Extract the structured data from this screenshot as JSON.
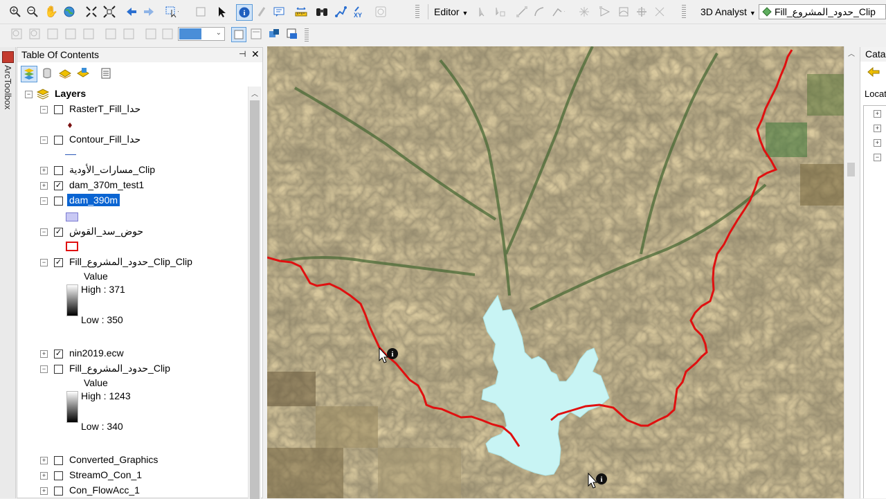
{
  "toolbar": {
    "editor_label": "Editor",
    "analyst_label": "3D Analyst",
    "layer_dropdown": "Fill_حدود_المشروع_Clip",
    "zoom_box": "",
    "xy_label": "XY"
  },
  "arctoolbox": {
    "label": "ArcToolbox"
  },
  "toc": {
    "title": "Table Of Contents",
    "pin_label": "📌",
    "close_label": "✕",
    "root": "Layers",
    "layers": [
      {
        "name": "RasterT_Fill_حدا",
        "checked": false
      },
      {
        "name": "Contour_Fill_حدا",
        "checked": false
      },
      {
        "name": "مسارات_الأودية_Clip",
        "checked": false
      },
      {
        "name": "dam_370m_test1",
        "checked": true
      },
      {
        "name": "dam_390m",
        "checked": false
      },
      {
        "name": "حوض_سد_القوش",
        "checked": true
      },
      {
        "name": "Fill_حدود_المشروع_Clip_Clip",
        "checked": true
      },
      {
        "name": "nin2019.ecw",
        "checked": true
      },
      {
        "name": "Fill_حدود_المشروع_Clip",
        "checked": false
      },
      {
        "name": "Converted_Graphics",
        "checked": false
      },
      {
        "name": "StreamO_Con_1",
        "checked": false
      },
      {
        "name": "Con_FlowAcc_1",
        "checked": false
      }
    ],
    "legend1": {
      "value_label": "Value",
      "high": "High : 371",
      "low": "Low : 350"
    },
    "legend2": {
      "value_label": "Value",
      "high": "High : 1243",
      "low": "Low : 340"
    }
  },
  "catalog": {
    "title": "Catal",
    "location_label": "Locatio"
  },
  "colors": {
    "boundary": "#e01010",
    "reservoir": "#c8f4f4",
    "selection": "#0a64d2"
  }
}
